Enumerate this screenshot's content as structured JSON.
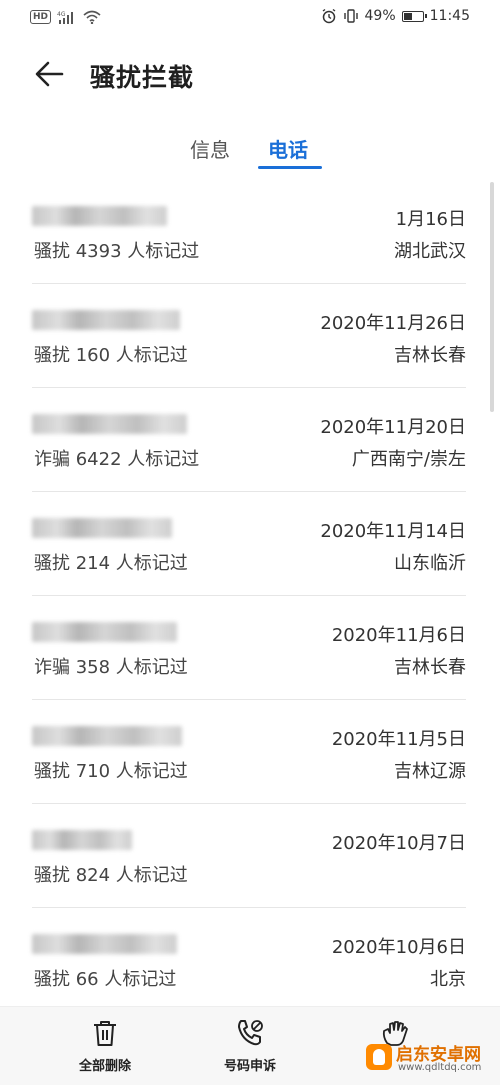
{
  "status_bar": {
    "network_badge": "HD",
    "network_type": "4G",
    "battery": "49%",
    "battery_level": 0.49,
    "time": "11:45"
  },
  "header": {
    "title": "骚扰拦截"
  },
  "tabs": [
    {
      "label": "信息",
      "active": false
    },
    {
      "label": "电话",
      "active": true
    }
  ],
  "calls": [
    {
      "date": "1月16日",
      "tag": "骚扰  4393 人标记过",
      "location": "湖北武汉"
    },
    {
      "date": "2020年11月26日",
      "tag": "骚扰  160 人标记过",
      "location": "吉林长春"
    },
    {
      "date": "2020年11月20日",
      "tag": "诈骗  6422 人标记过",
      "location": "广西南宁/崇左"
    },
    {
      "date": "2020年11月14日",
      "tag": "骚扰  214 人标记过",
      "location": "山东临沂"
    },
    {
      "date": "2020年11月6日",
      "tag": "诈骗  358 人标记过",
      "location": "吉林长春"
    },
    {
      "date": "2020年11月5日",
      "tag": "骚扰  710 人标记过",
      "location": "吉林辽源"
    },
    {
      "date": "2020年10月7日",
      "tag": "骚扰  824 人标记过",
      "location": ""
    },
    {
      "date": "2020年10月6日",
      "tag": "骚扰  66 人标记过",
      "location": "北京"
    }
  ],
  "bottom_bar": {
    "delete_all": "全部删除",
    "number_appeal": "号码申诉",
    "report_label": ""
  },
  "watermark": {
    "name": "启东安卓网",
    "url": "www.qdltdq.com"
  },
  "colors": {
    "accent": "#1a6fd8",
    "watermark": "#e07000"
  }
}
